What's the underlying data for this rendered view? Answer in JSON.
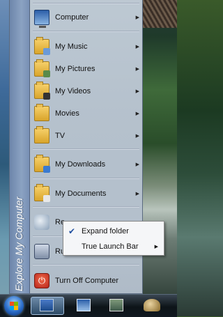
{
  "start_menu": {
    "side_label": "Explore My Computer",
    "items": [
      {
        "label": "Computer",
        "icon": "computer-icon",
        "submenu": true
      },
      {
        "label": "My Music",
        "icon": "music-folder-icon",
        "submenu": true
      },
      {
        "label": "My Pictures",
        "icon": "pictures-folder-icon",
        "submenu": true
      },
      {
        "label": "My Videos",
        "icon": "videos-folder-icon",
        "submenu": true
      },
      {
        "label": "Movies",
        "icon": "movies-folder-icon",
        "submenu": true
      },
      {
        "label": "TV",
        "icon": "tv-folder-icon",
        "submenu": true
      },
      {
        "label": "My Downloads",
        "icon": "downloads-folder-icon",
        "submenu": true
      },
      {
        "label": "My Documents",
        "icon": "documents-folder-icon",
        "submenu": true
      },
      {
        "label": "Re",
        "icon": "recent-icon",
        "submenu": false
      },
      {
        "label": "Ru",
        "icon": "run-icon",
        "submenu": false
      },
      {
        "label": "Turn Off Computer",
        "icon": "power-icon",
        "submenu": false
      }
    ]
  },
  "context_menu": {
    "items": [
      {
        "label": "Expand folder",
        "checked": true,
        "submenu": false
      },
      {
        "label": "True Launch Bar",
        "checked": false,
        "submenu": true
      }
    ]
  },
  "taskbar": {
    "buttons": [
      "start-orb",
      "true-launch-bar-app",
      "computer",
      "window",
      "chess"
    ]
  }
}
